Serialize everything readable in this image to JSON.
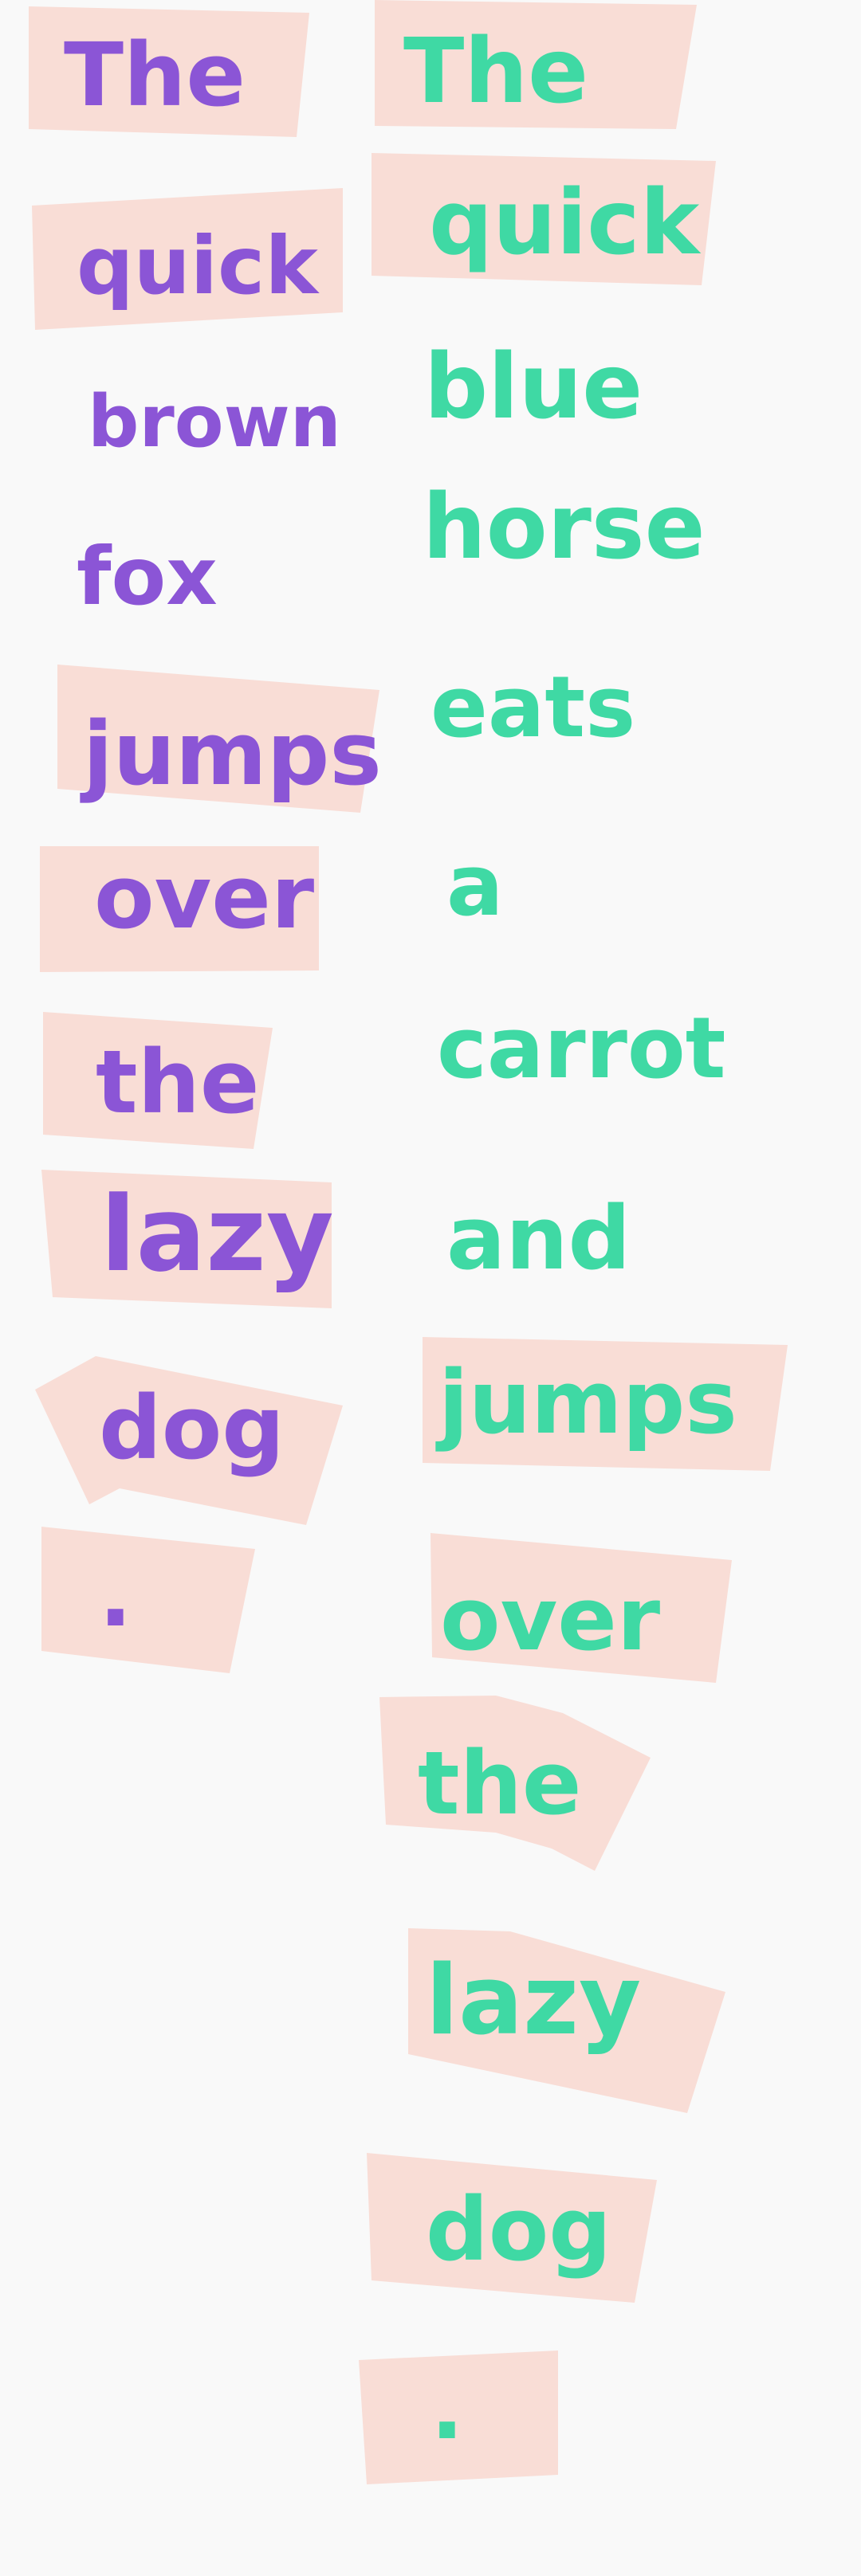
{
  "colors": {
    "background": "#f9f9f9",
    "highlight": "#f9ddd6",
    "left_ink": "#8b55d6",
    "right_ink": "#3fd9a4"
  },
  "left_sentence": {
    "words": [
      {
        "text": "The",
        "highlighted": true
      },
      {
        "text": "quick",
        "highlighted": true
      },
      {
        "text": "brown",
        "highlighted": false
      },
      {
        "text": "fox",
        "highlighted": false
      },
      {
        "text": "jumps",
        "highlighted": true
      },
      {
        "text": "over",
        "highlighted": true
      },
      {
        "text": "the",
        "highlighted": true
      },
      {
        "text": "lazy",
        "highlighted": true
      },
      {
        "text": "dog",
        "highlighted": true
      },
      {
        "text": ".",
        "highlighted": true
      }
    ]
  },
  "right_sentence": {
    "words": [
      {
        "text": "The",
        "highlighted": true
      },
      {
        "text": "quick",
        "highlighted": true
      },
      {
        "text": "blue",
        "highlighted": false
      },
      {
        "text": "horse",
        "highlighted": false
      },
      {
        "text": "eats",
        "highlighted": false
      },
      {
        "text": "a",
        "highlighted": false
      },
      {
        "text": "carrot",
        "highlighted": false
      },
      {
        "text": "and",
        "highlighted": false
      },
      {
        "text": "jumps",
        "highlighted": true
      },
      {
        "text": "over",
        "highlighted": true
      },
      {
        "text": "the",
        "highlighted": true
      },
      {
        "text": "lazy",
        "highlighted": true
      },
      {
        "text": "dog",
        "highlighted": true
      },
      {
        "text": ".",
        "highlighted": true
      }
    ]
  }
}
